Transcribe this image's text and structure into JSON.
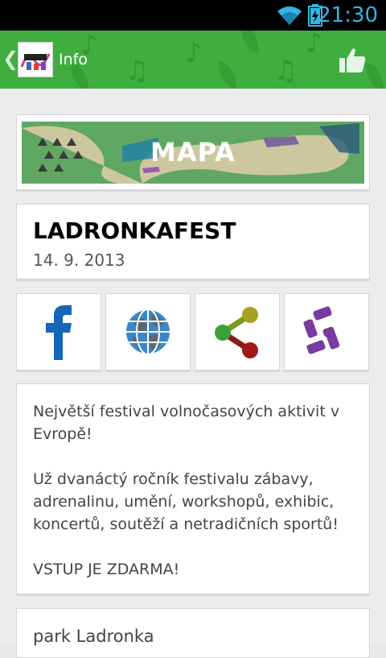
{
  "status_bar": {
    "time": "21:30",
    "wifi_icon": "wifi-icon",
    "battery_icon": "battery-charging-icon"
  },
  "action_bar": {
    "title": "Info",
    "back_icon": "chevron-left-icon",
    "like_icon": "thumbs-up-icon",
    "background_color": "#3fae3f"
  },
  "map_card": {
    "label": "MAPA"
  },
  "event": {
    "name": "LADRONKAFEST",
    "date": "14. 9. 2013"
  },
  "share_buttons": [
    {
      "icon": "facebook-icon"
    },
    {
      "icon": "globe-icon"
    },
    {
      "icon": "share-icon"
    },
    {
      "icon": "g-logo-icon"
    }
  ],
  "description": {
    "para1": "Největší festival volnočasových aktivit v Evropě!",
    "para2": "Už dvanáctý ročník festivalu zábavy, adrenalinu, umění, workshopů, exhibic, koncertů, soutěží a netradičních sportů!",
    "para3": "VSTUP JE ZDARMA!"
  },
  "location": {
    "place": "park Ladronka"
  }
}
